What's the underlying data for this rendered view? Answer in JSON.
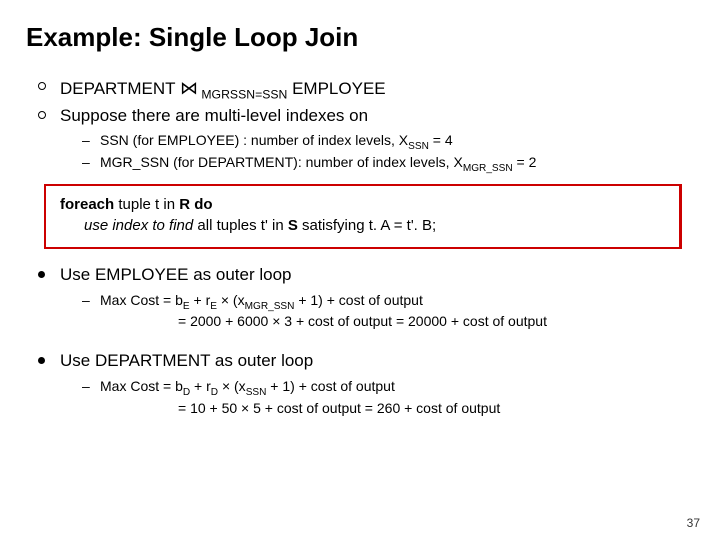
{
  "title": "Example: Single Loop Join",
  "b1_pre": "DEPARTMENT ",
  "b1_join": "⋈",
  "b1_sub": " MGRSSN=SSN",
  "b1_post": " EMPLOYEE",
  "b2": "Suppose there are multi-level indexes on",
  "b2s1_a": "SSN (for EMPLOYEE) : number of index levels, X",
  "b2s1_sub": "SSN",
  "b2s1_b": " = 4",
  "b2s2_a": "MGR_SSN (for DEPARTMENT): number of index levels, X",
  "b2s2_sub": "MGR_SSN",
  "b2s2_b": " = 2",
  "code_l1_a": "foreach",
  "code_l1_b": " tuple t  in  ",
  "code_l1_c": "R  do",
  "code_l2_a": "use index to find",
  "code_l2_b": " all tuples t' in ",
  "code_l2_c": "S",
  "code_l2_d": " satisfying t. A = t'. B;",
  "b3": "Use EMPLOYEE as outer loop",
  "b3s1_a": "Max Cost = b",
  "b3s1_s1": "E",
  "b3s1_b": " + r",
  "b3s1_s2": "E",
  "b3s1_c": " × (x",
  "b3s1_s3": "MGR_SSN",
  "b3s1_d": " + 1) + cost of output",
  "b3s2": "= 2000 + 6000 × 3 + cost of output = 20000 + cost of output",
  "b4": "Use DEPARTMENT as outer loop",
  "b4s1_a": "Max Cost = b",
  "b4s1_s1": "D",
  "b4s1_b": " + r",
  "b4s1_s2": "D",
  "b4s1_c": " × (x",
  "b4s1_s3": "SSN",
  "b4s1_d": " + 1) + cost of output",
  "b4s2": "= 10 + 50 × 5 + cost of output = 260 + cost of output",
  "page": "37"
}
